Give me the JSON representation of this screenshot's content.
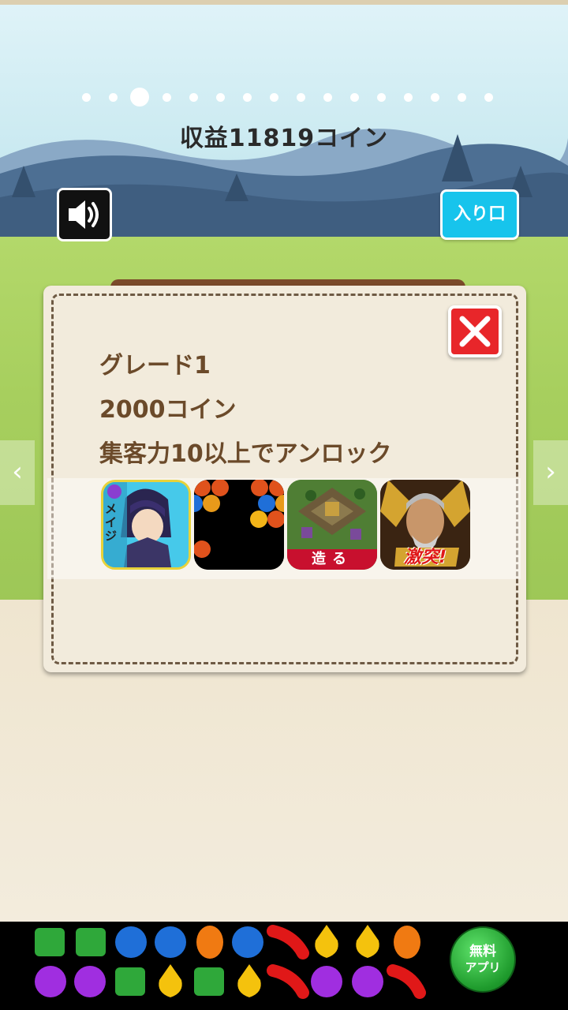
{
  "header": {
    "revenue_text": "収益11819コイン",
    "pagination": {
      "count": 16,
      "active_index": 2
    }
  },
  "controls": {
    "sound_icon": "speaker-icon",
    "entrance_label": "入り口",
    "nav_left_glyph": "‹",
    "nav_right_glyph": "›"
  },
  "panel": {
    "grade": "グレード1",
    "price": "2000コイン",
    "unlock": "集客力10以上でアンロック",
    "close_icon": "close-icon"
  },
  "ads": {
    "apps": [
      {
        "name": "mage-character-app",
        "badge": "メイジ"
      },
      {
        "name": "bubble-shooter-app",
        "badge": ""
      },
      {
        "name": "village-building-app",
        "badge": "造る"
      },
      {
        "name": "samurai-warrior-app",
        "badge": "激突!"
      }
    ]
  },
  "banner": {
    "free_app_label_1": "無料",
    "free_app_label_2": "アプリ"
  },
  "colors": {
    "accent_cyan": "#17c4ec",
    "close_red": "#e8262a",
    "panel_text_brown": "#6b4a2a",
    "free_app_green": "#1e9a2c"
  }
}
